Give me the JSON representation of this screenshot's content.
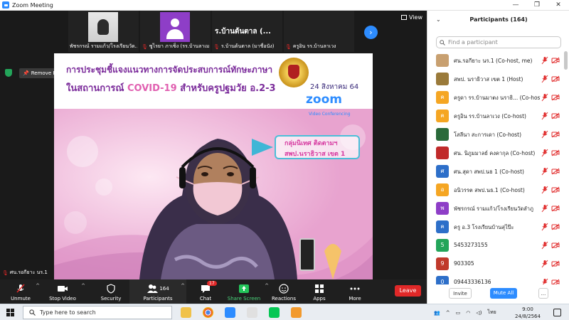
{
  "window": {
    "title": "Zoom Meeting",
    "controls": [
      "—",
      "❐",
      "⤢",
      "✕"
    ]
  },
  "thumbnails": [
    {
      "name": "พัชรกรณ์ รามแก้ว/โรงเรียนวัด...",
      "type": "photo"
    },
    {
      "name": "ซูไรยา ภาเซ็ง (รร.บ้านลาเม...",
      "type": "avatar",
      "avatar_color": "#8e3ec7"
    },
    {
      "name": "ร.บ้านต้นตาล (มาชื่อนัง)",
      "type": "text",
      "display_text": "ร.บ้านต้นตาล (..."
    },
    {
      "name": "ครูอิน รร.บ้านลาเวง",
      "type": "blank"
    }
  ],
  "view_button": {
    "label": "View"
  },
  "pin": {
    "label": "Remove Pin"
  },
  "shared": {
    "title_line1": "การประชุมชี้แจงแนวทางการจัดประสบการณ์ทักษะภาษา",
    "title_line2_a": "ในสถานการณ์ ",
    "title_line2_b": "COVID-19",
    "title_line2_c": " สำหรับครูปฐมวัย อ.2-3",
    "date": "24 สิงหาคม 64",
    "zoom_logo": "zoom",
    "zoom_sub": "Video Conferencing",
    "group_line1": "กลุ่มนิเทศ ติดตามฯ",
    "group_line2": "สพป.นราธิวาส เขต 1"
  },
  "speaker_label": "ศน.รอกียาะ นร.1",
  "toolbar": {
    "unmute": "Unmute",
    "stop_video": "Stop Video",
    "security": "Security",
    "participants": "Participants",
    "participants_count": "164",
    "chat": "Chat",
    "chat_badge": "17",
    "share_screen": "Share Screen",
    "reactions": "Reactions",
    "apps": "Apps",
    "more": "More",
    "leave": "Leave"
  },
  "panel": {
    "title": "Participants (164)",
    "search_placeholder": "Find a participant",
    "participants": [
      {
        "name": "ศน.รอกียาะ นร.1 (Co-host, me)",
        "avatar": "photo",
        "color": "#c8a070"
      },
      {
        "name": "สพป. นราธิวาส เขต 1 (Host)",
        "avatar": "photo",
        "color": "#9a7a3a"
      },
      {
        "name": "ครูดา รร.บ้านมาตง นราธิ... (Co-host)",
        "avatar": "ค",
        "color": "#f5a623"
      },
      {
        "name": "ครูอิน รร.บ้านลาเวง (Co-host)",
        "avatar": "ค",
        "color": "#f5a623"
      },
      {
        "name": "โสลีนา สะการเดา (Co-host)",
        "avatar": "photo",
        "color": "#2a6a3a"
      },
      {
        "name": "ศน. นิภูมมาลย์ คงคากุล (Co-host)",
        "avatar": "photo",
        "color": "#c02a2a"
      },
      {
        "name": "ศน.สุดา สพป.นธ 1 (Co-host)",
        "avatar": "ศ",
        "color": "#2d6fc9"
      },
      {
        "name": "อนิวรรต สพป.นธ.1 (Co-host)",
        "avatar": "อ",
        "color": "#f5a623"
      },
      {
        "name": "พัชรกรณ์ รามแก้ว/โรงเรียนวัดลำภู",
        "avatar": "พ",
        "color": "#8e3ec7"
      },
      {
        "name": "ครู อ.3 โรงเรียนบ้านสุไป๊ะ",
        "avatar": "ค",
        "color": "#2d6fc9"
      },
      {
        "name": "5453273155",
        "avatar": "5",
        "color": "#23a55a"
      },
      {
        "name": "903305",
        "avatar": "9",
        "color": "#c0392b"
      },
      {
        "name": "09443336136",
        "avatar": "0",
        "color": "#2d6fc9"
      }
    ],
    "invite": "Invite",
    "mute_all": "Mute All",
    "more": "..."
  },
  "taskbar": {
    "search_placeholder": "Type here to search",
    "lang": "ไทย",
    "time": "9:00",
    "date": "24/8/2564"
  }
}
